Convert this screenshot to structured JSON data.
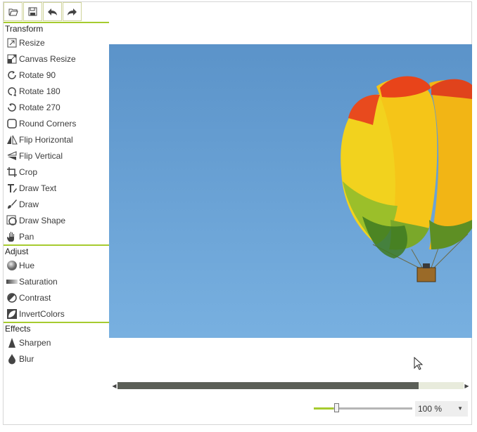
{
  "toolbar": {
    "buttons": [
      {
        "icon": "open-folder-icon"
      },
      {
        "icon": "save-icon"
      },
      {
        "icon": "undo-icon"
      },
      {
        "icon": "redo-icon"
      }
    ]
  },
  "groups": {
    "transform": {
      "title": "Transform",
      "items": [
        {
          "label": "Resize",
          "icon": "resize-icon"
        },
        {
          "label": "Canvas Resize",
          "icon": "canvas-resize-icon"
        },
        {
          "label": "Rotate 90",
          "icon": "rotate-90-icon"
        },
        {
          "label": "Rotate 180",
          "icon": "rotate-180-icon"
        },
        {
          "label": "Rotate 270",
          "icon": "rotate-270-icon"
        },
        {
          "label": "Round Corners",
          "icon": "round-corners-icon"
        },
        {
          "label": "Flip Horizontal",
          "icon": "flip-horizontal-icon"
        },
        {
          "label": "Flip Vertical",
          "icon": "flip-vertical-icon"
        },
        {
          "label": "Crop",
          "icon": "crop-icon"
        },
        {
          "label": "Draw Text",
          "icon": "draw-text-icon"
        },
        {
          "label": "Draw",
          "icon": "brush-icon"
        },
        {
          "label": "Draw Shape",
          "icon": "draw-shape-icon"
        },
        {
          "label": "Pan",
          "icon": "hand-icon"
        }
      ]
    },
    "adjust": {
      "title": "Adjust",
      "items": [
        {
          "label": "Hue",
          "icon": "hue-icon"
        },
        {
          "label": "Saturation",
          "icon": "saturation-icon"
        },
        {
          "label": "Contrast",
          "icon": "contrast-icon"
        },
        {
          "label": "InvertColors",
          "icon": "invert-colors-icon"
        }
      ]
    },
    "effects": {
      "title": "Effects",
      "items": [
        {
          "label": "Sharpen",
          "icon": "sharpen-icon"
        },
        {
          "label": "Blur",
          "icon": "blur-icon"
        }
      ]
    }
  },
  "scrollbar": {
    "position_fraction": 0.87
  },
  "zoom": {
    "slider_fraction": 0.2,
    "value": "100 %"
  },
  "colors": {
    "accent": "#a6cb2f",
    "sky": "#6aa2d6"
  }
}
